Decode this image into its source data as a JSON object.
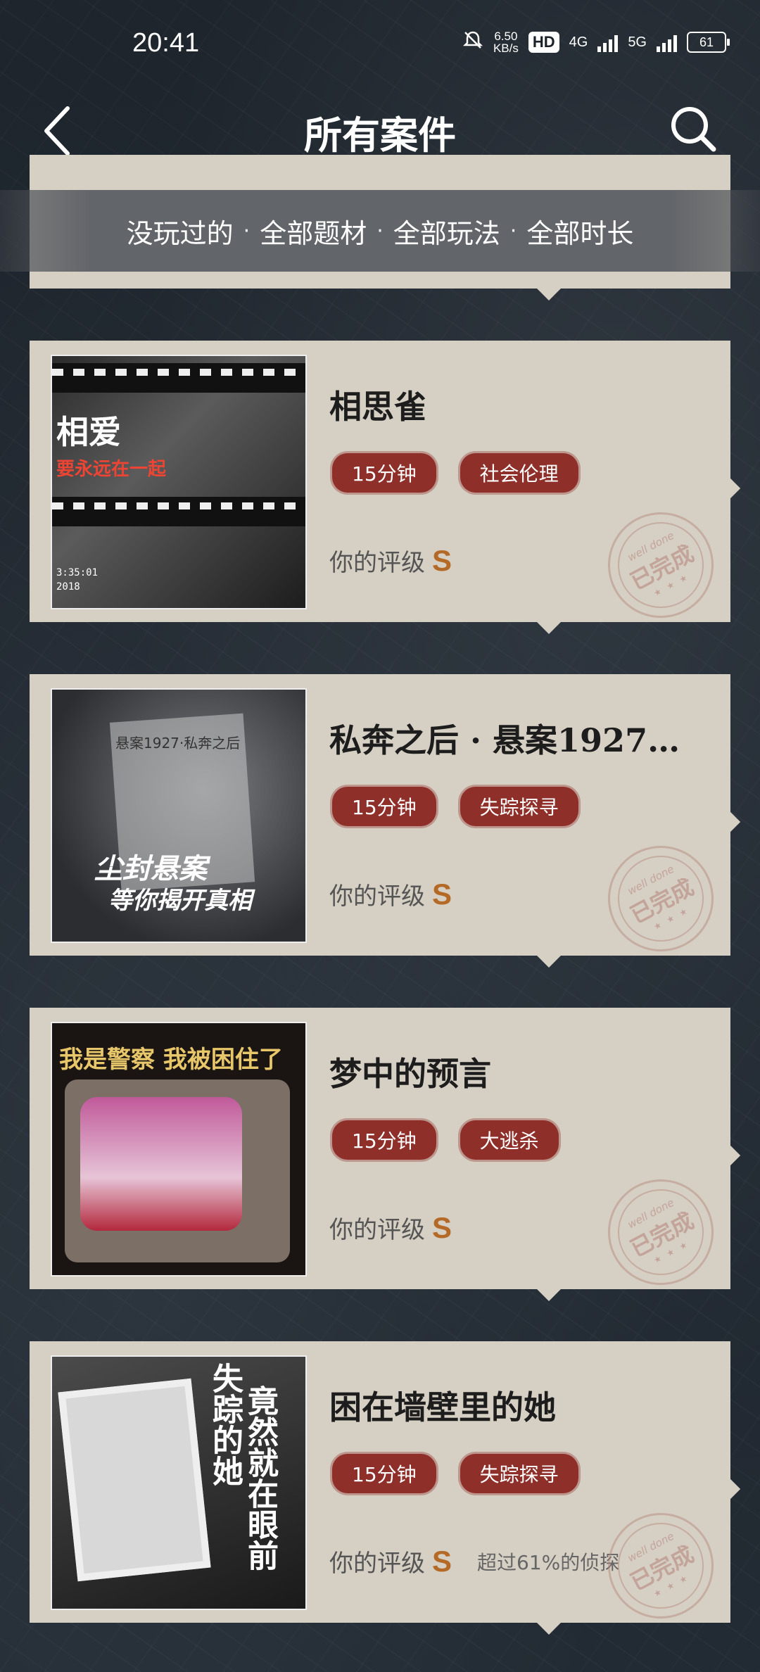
{
  "status_bar": {
    "time": "20:41",
    "net_speed_value": "6.50",
    "net_speed_unit": "KB/s",
    "hd_label": "HD",
    "network1": "4G",
    "network2": "5G",
    "battery": "61"
  },
  "header": {
    "title": "所有案件"
  },
  "filter": {
    "items": [
      "没玩过的",
      "全部题材",
      "全部玩法",
      "全部时长"
    ],
    "separator": "·"
  },
  "rating_label": "你的评级",
  "stamp": {
    "en": "well done",
    "cn": "已完成",
    "stars": "★ ★ ★"
  },
  "cases": [
    {
      "title": "相思雀",
      "tags": [
        "15分钟",
        "社会伦理"
      ],
      "grade": "S",
      "beat": "",
      "thumb_text": [
        "相爱",
        "要永远在一起",
        "3:35:01",
        "2018"
      ]
    },
    {
      "title": "私奔之后 · 悬案1927…",
      "tags": [
        "15分钟",
        "失踪探寻"
      ],
      "grade": "S",
      "beat": "",
      "thumb_text": [
        "悬案1927·私奔之后",
        "尘封悬案",
        "等你揭开真相"
      ]
    },
    {
      "title": "梦中的预言",
      "tags": [
        "15分钟",
        "大逃杀"
      ],
      "grade": "S",
      "beat": "",
      "thumb_text": [
        "我是警察 我被困住了"
      ]
    },
    {
      "title": "困在墙壁里的她",
      "tags": [
        "15分钟",
        "失踪探寻"
      ],
      "grade": "S",
      "beat": "超过61%的侦探",
      "thumb_text": [
        "失踪的她",
        "竟然就在眼前"
      ]
    }
  ],
  "colors": {
    "card_bg": "#d6cfc3",
    "tag_bg": "#8f2f2a",
    "grade": "#b46a26"
  }
}
